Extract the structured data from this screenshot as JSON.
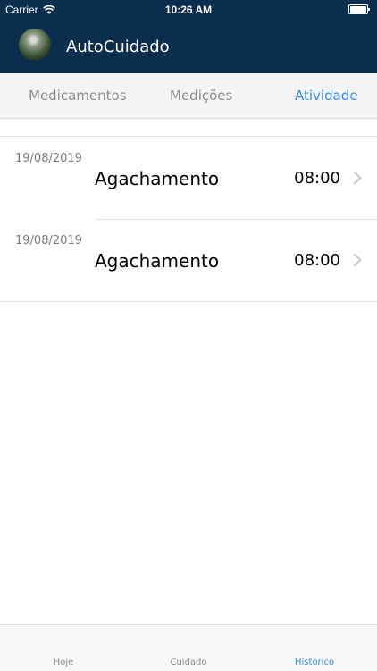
{
  "status_bar": {
    "carrier": "Carrier",
    "time": "10:26 AM"
  },
  "header": {
    "title": "AutoCuidado"
  },
  "segments": [
    {
      "label": "Medicamentos",
      "active": false
    },
    {
      "label": "Medições",
      "active": false
    },
    {
      "label": "Atividade",
      "active": true
    }
  ],
  "history": [
    {
      "date": "19/08/2019",
      "title": "Agachamento",
      "time": "08:00"
    },
    {
      "date": "19/08/2019",
      "title": "Agachamento",
      "time": "08:00"
    }
  ],
  "tab_bar": [
    {
      "label": "Hoje",
      "active": false
    },
    {
      "label": "Cuidado",
      "active": false
    },
    {
      "label": "Histórico",
      "active": true
    }
  ],
  "colors": {
    "header_bg": "#0b2d4e",
    "accent": "#3a8be0"
  }
}
